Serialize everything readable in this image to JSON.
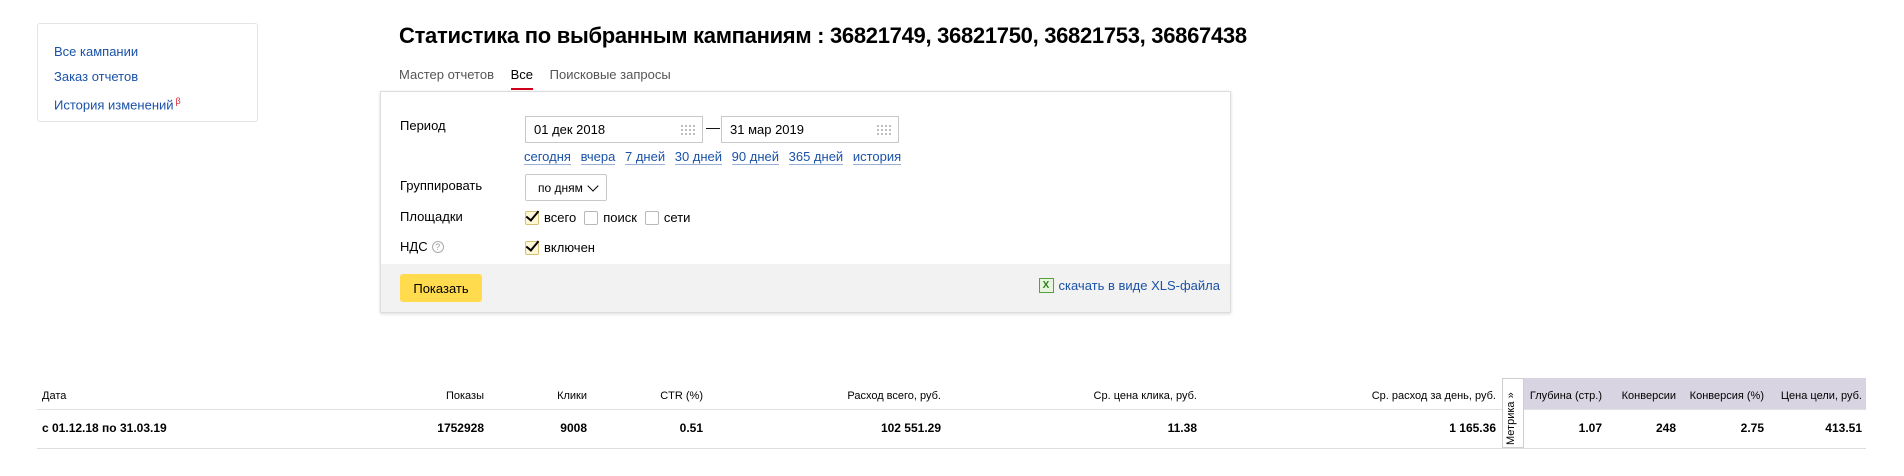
{
  "sidebar": {
    "links": [
      "Все кампании",
      "Заказ отчетов",
      "История изменений"
    ],
    "history_badge": "β"
  },
  "page_title": "Статистика по выбранным кампаниям : 36821749, 36821750, 36821753, 36867438",
  "tabs": [
    {
      "label": "Мастер отчетов",
      "active": false
    },
    {
      "label": "Все",
      "active": true
    },
    {
      "label": "Поисковые запросы",
      "active": false
    }
  ],
  "form": {
    "period_label": "Период",
    "date_from": "01 дек 2018",
    "date_to": "31 мар 2019",
    "dash": "—",
    "quick_ranges": [
      "сегодня",
      "вчера",
      "7 дней",
      "30 дней",
      "90 дней",
      "365 дней",
      "история"
    ],
    "group_label": "Группировать",
    "group_value": "по дням",
    "platforms_label": "Площадки",
    "platforms": [
      {
        "label": "всего",
        "checked": true
      },
      {
        "label": "поиск",
        "checked": false
      },
      {
        "label": "сети",
        "checked": false
      }
    ],
    "vat_label": "НДС",
    "vat_help": "?",
    "vat_option": {
      "label": "включен",
      "checked": true
    },
    "show_button": "Показать",
    "xls_link": "скачать в виде XLS-файла",
    "xls_icon_text": "X"
  },
  "table": {
    "columns": [
      "Дата",
      "Показы",
      "Клики",
      "CTR (%)",
      "Расход всего, руб.",
      "Ср. цена клика, руб.",
      "Ср. расход за день, руб."
    ],
    "metrika_columns": [
      "Глубина (стр.)",
      "Конверсии",
      "Конверсия (%)",
      "Цена цели, руб."
    ],
    "metrika_tab": "Метрика »",
    "row": {
      "date": "с 01.12.18 по 31.03.19",
      "shows": "1752928",
      "clicks": "9008",
      "ctr": "0.51",
      "spend_total": "102 551.29",
      "avg_click_price": "11.38",
      "avg_daily_spend": "1 165.36",
      "depth": "1.07",
      "conversions": "248",
      "conversion_rate": "2.75",
      "goal_price": "413.51"
    }
  },
  "colors": {
    "link": "#1a52a8",
    "accent_button": "#ffdb4d",
    "active_tab": "#d0021b",
    "metrika_header": "#d9d4e2"
  }
}
